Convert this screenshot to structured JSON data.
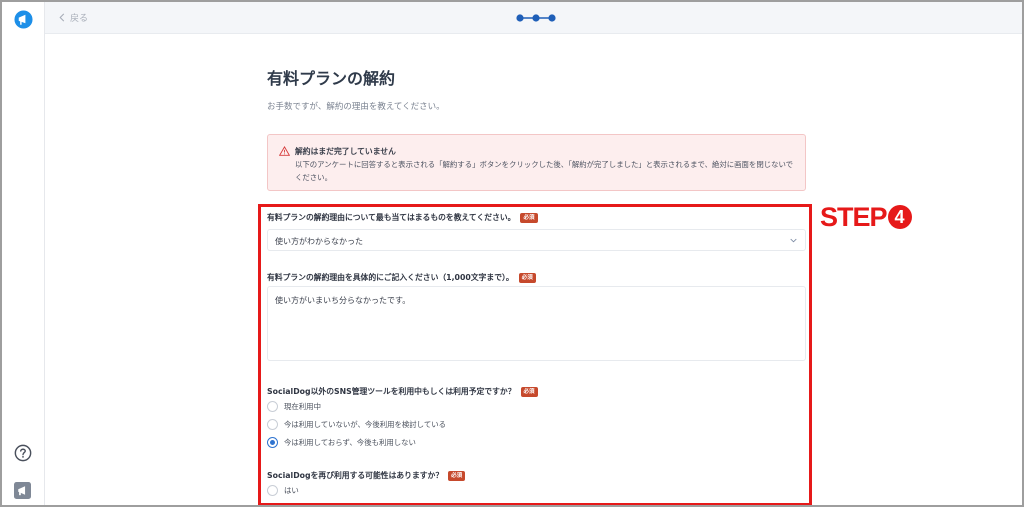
{
  "topbar": {
    "back_label": "戻る"
  },
  "page": {
    "title": "有料プランの解約",
    "subtitle": "お手数ですが、解約の理由を教えてください。"
  },
  "alert": {
    "title": "解約はまだ完了していません",
    "body": "以下のアンケートに回答すると表示される「解約する」ボタンをクリックした後、「解約が完了しました」と表示されるまで、絶対に画面を閉じないでください。"
  },
  "form": {
    "required_badge": "必須",
    "q1": {
      "label": "有料プランの解約理由について最も当てはまるものを教えてください。",
      "selected": "使い方がわからなかった"
    },
    "q2": {
      "label": "有料プランの解約理由を具体的にご記入ください（1,000文字まで）。",
      "value": "使い方がいまいち分らなかったです。"
    },
    "q3": {
      "label": "SocialDog以外のSNS管理ツールを利用中もしくは利用予定ですか？",
      "options": [
        "現在利用中",
        "今は利用していないが、今後利用を検討している",
        "今は利用しておらず、今後も利用しない"
      ],
      "selected_index": 2
    },
    "q4": {
      "label": "SocialDogを再び利用する可能性はありますか？",
      "options": [
        "はい"
      ]
    }
  },
  "annotation": {
    "step_text": "STEP",
    "step_number": "4"
  },
  "colors": {
    "accent": "#2f74d0",
    "badge": "#c6492c",
    "highlight": "#e61919",
    "alert_bg": "#fdeeee",
    "logo": "#1d8fe8"
  },
  "icons": [
    "socialdog-logo-icon",
    "chevron-left-icon",
    "step-progress-icon",
    "warning-icon",
    "chevron-down-icon",
    "help-icon",
    "megaphone-icon"
  ]
}
